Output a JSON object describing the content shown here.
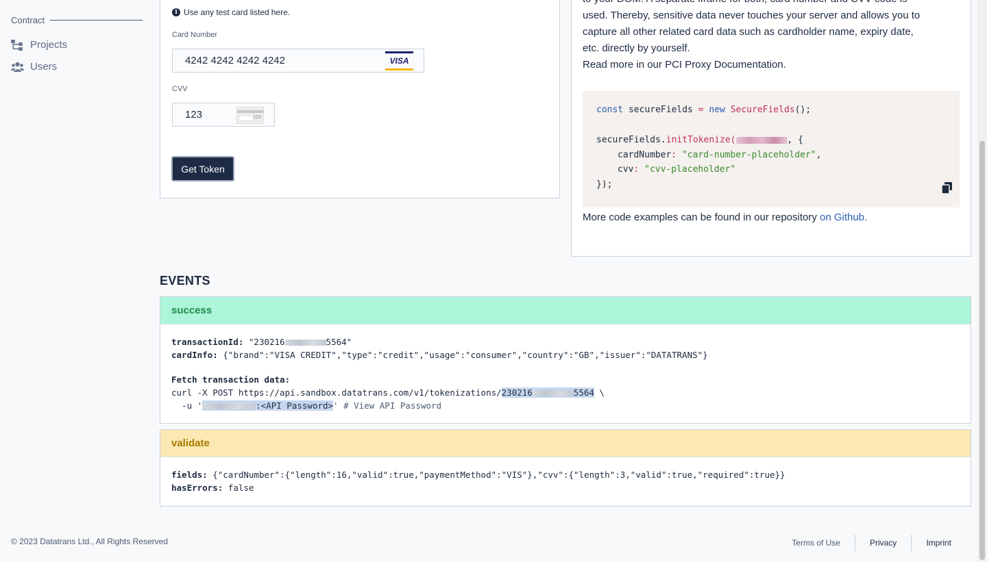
{
  "sidebar": {
    "contract_label": "Contract",
    "items": [
      {
        "label": "Projects",
        "icon": "sitemap-icon"
      },
      {
        "label": "Users",
        "icon": "users-icon"
      }
    ]
  },
  "form": {
    "info_text": "Use any test card listed",
    "info_link": "here.",
    "card_number_label": "Card Number",
    "card_number_value": "4242 4242 4242 4242",
    "card_brand": "VISA",
    "cvv_label": "CVV",
    "cvv_value": "123",
    "cvv_card_digits": "123",
    "submit_label": "Get Token"
  },
  "docs": {
    "line1": "to your DOM. A separate iframe for both, card number and CVV code is",
    "line2": "used. Thereby, sensitive data never touches your server and allows you to",
    "line3": "capture all other related card data such as cardholder name, expiry date,",
    "line4": "etc. directly by yourself.",
    "read_more_prefix": "Read more in our",
    "read_more_link": "PCI Proxy Documentation.",
    "code": {
      "kw_const": "const",
      "var_name": "secureFields",
      "eq": "=",
      "kw_new": "new",
      "class_name": "SecureFields",
      "ctor_tail": "();",
      "call_obj": "secureFields",
      "call_fn": "initTokenize",
      "call_open": "(",
      "call_tail": ", {",
      "prop1": "cardNumber",
      "val1": "\"card-number-placeholder\"",
      "prop2": "cvv",
      "val2": "\"cvv-placeholder\"",
      "close": "});"
    },
    "more_prefix": "More code examples can be found in our repository",
    "more_link": "on Github."
  },
  "events": {
    "title": "EVENTS",
    "success": {
      "name": "success",
      "transaction_key": "transactionId:",
      "transaction_prefix": "\"230216",
      "transaction_suffix": "5564\"",
      "cardinfo_key": "cardInfo:",
      "cardinfo_value": "{\"brand\":\"VISA CREDIT\",\"type\":\"credit\",\"usage\":\"consumer\",\"country\":\"GB\",\"issuer\":\"DATATRANS\"}",
      "fetch_label": "Fetch transaction data:",
      "curl_prefix": "curl -X POST https://api.sandbox.datatrans.com/v1/tokenizations/",
      "curl_id_prefix": "230216",
      "curl_id_suffix": "5564",
      "curl_tail": " \\",
      "user_prefix": "  -u '",
      "user_pw": ":<API Password>",
      "user_tail": "' # View API Password"
    },
    "validate": {
      "name": "validate",
      "fields_key": "fields:",
      "fields_value": "{\"cardNumber\":{\"length\":16,\"valid\":true,\"paymentMethod\":\"VIS\"},\"cvv\":{\"length\":3,\"valid\":true,\"required\":true}}",
      "errors_key": "hasErrors:",
      "errors_value": "false"
    }
  },
  "footer": {
    "copyright": "© 2023 Datatrans Ltd., All Rights Reserved",
    "terms": "Terms of Use",
    "privacy": "Privacy",
    "imprint": "Imprint"
  }
}
